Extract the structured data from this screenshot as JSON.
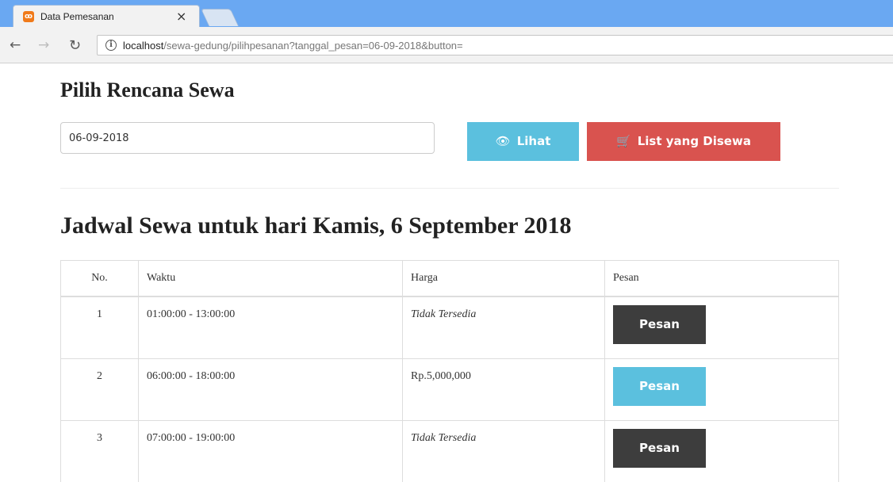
{
  "browser": {
    "tab_title": "Data Pemesanan",
    "tab_close": "×",
    "url_host": "localhost",
    "url_rest": "/sewa-gedung/pilihpesanan?tanggal_pesan=06-09-2018&button=",
    "icons": {
      "back": "arrow-left",
      "forward": "arrow-right",
      "reload": "reload",
      "info": "info-circle",
      "favicon": "xampp"
    }
  },
  "page": {
    "title": "Pilih Rencana Sewa",
    "date_value": "06-09-2018",
    "lihat_label": "Lihat",
    "list_label": "List yang Disewa",
    "section_title": "Jadwal Sewa untuk hari Kamis, 6 September 2018",
    "colors": {
      "info": "#5bc0de",
      "danger": "#d9534f",
      "dark": "#3d3d3d"
    }
  },
  "table": {
    "headers": [
      "No.",
      "Waktu",
      "Harga",
      "Pesan"
    ],
    "rows": [
      {
        "no": "1",
        "waktu": "01:00:00 - 13:00:00",
        "harga": "Tidak Tersedia",
        "pesan": "Pesan"
      },
      {
        "no": "2",
        "waktu": "06:00:00 - 18:00:00",
        "harga": "Rp.5,000,000",
        "pesan": "Pesan"
      },
      {
        "no": "3",
        "waktu": "07:00:00 - 19:00:00",
        "harga": "Tidak Tersedia",
        "pesan": "Pesan"
      }
    ]
  }
}
